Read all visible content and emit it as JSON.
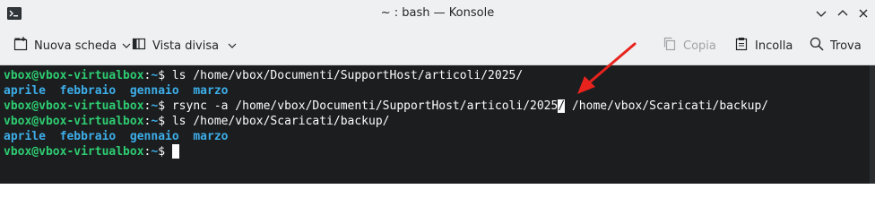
{
  "window": {
    "title": "~ : bash — Konsole"
  },
  "toolbar": {
    "new_tab_label": "Nuova scheda",
    "split_view_label": "Vista divisa",
    "copy_label": "Copia",
    "paste_label": "Incolla",
    "find_label": "Trova"
  },
  "terminal": {
    "prompt_user": "vbox@vbox-virtualbox",
    "prompt_path": "~",
    "prompt_symbol": "$",
    "lines": [
      {
        "type": "command",
        "text": "ls /home/vbox/Documenti/SupportHost/articoli/2025/"
      },
      {
        "type": "output",
        "items": [
          "aprile",
          "febbraio",
          "gennaio",
          "marzo"
        ]
      },
      {
        "type": "command",
        "text_before": "rsync -a /home/vbox/Documenti/SupportHost/articoli/2025",
        "selected_char": "/",
        "text_after": " /home/vbox/Scaricati/backup/"
      },
      {
        "type": "command",
        "text": "ls /home/vbox/Scaricati/backup/"
      },
      {
        "type": "output",
        "items": [
          "aprile",
          "febbraio",
          "gennaio",
          "marzo"
        ]
      },
      {
        "type": "prompt"
      }
    ]
  },
  "colors": {
    "terminal_bg": "#1b1d1f",
    "prompt_user": "#2ecc71",
    "prompt_path": "#3daee9",
    "directory": "#3daee9",
    "annotation_arrow": "#e8231e"
  },
  "icons": {
    "app": "terminal-icon",
    "new_tab": "new-tab-icon",
    "split_view": "split-view-icon",
    "copy": "copy-icon",
    "paste": "paste-icon",
    "find": "search-icon"
  }
}
